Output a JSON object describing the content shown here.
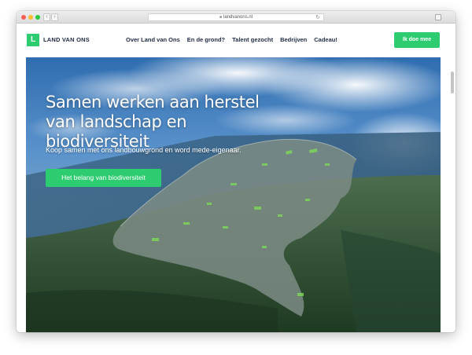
{
  "browser": {
    "url": "landvanons.nl"
  },
  "brand": {
    "logo_letter": "L",
    "name": "LAND VAN ONS",
    "accent_color": "#2ecc71"
  },
  "nav": {
    "items": [
      {
        "label": "Over Land van Ons"
      },
      {
        "label": "En de grond?"
      },
      {
        "label": "Talent gezocht"
      },
      {
        "label": "Bedrijven"
      },
      {
        "label": "Cadeau!"
      }
    ],
    "cta_label": "Ik doe mee"
  },
  "hero": {
    "title": "Samen werken aan herstel van landschap en biodiversiteit",
    "subtitle": "Koop samen met ons landbouwgrond en word mede-eigenaar.",
    "button_label": "Het belang van biodiversiteit"
  },
  "icons": {
    "lock": "lock-icon",
    "reload": "reload-icon",
    "back": "chevron-left-icon",
    "forward": "chevron-right-icon"
  }
}
